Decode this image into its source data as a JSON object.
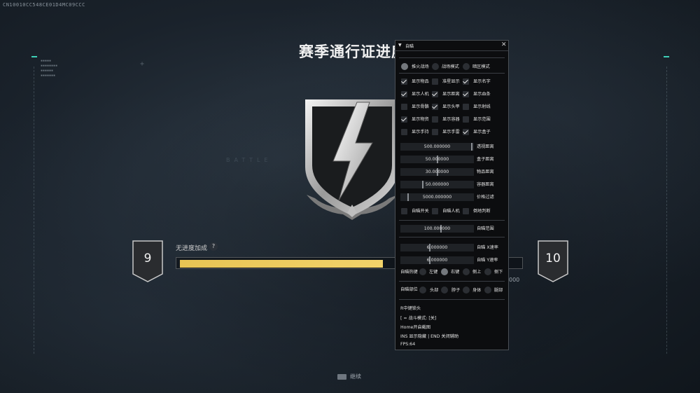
{
  "build_id": "CN10010CC548CE01D4MC09CCC",
  "screen": {
    "title": "赛季通行证进度",
    "current_level": "9",
    "next_level": "10",
    "progress_label": "无进度加成",
    "help_icon_text": "?",
    "progress_fraction": 0.6,
    "xp_suffix": "000",
    "continue_label": "继续",
    "badge_background_text": "BATTLE"
  },
  "menu": {
    "title": "自瞄",
    "close_glyph": "✕",
    "mode_radios": [
      {
        "label": "推火战场",
        "checked": true
      },
      {
        "label": "战场模式",
        "checked": false
      },
      {
        "label": "暗区模式",
        "checked": false
      }
    ],
    "checkboxes": [
      [
        {
          "label": "显示物品",
          "checked": true
        },
        {
          "label": "准星显示",
          "checked": false
        },
        {
          "label": "显示名字",
          "checked": true
        }
      ],
      [
        {
          "label": "显示人机",
          "checked": true
        },
        {
          "label": "显示距离",
          "checked": true
        },
        {
          "label": "显示血条",
          "checked": true
        }
      ],
      [
        {
          "label": "显示骨骼",
          "checked": false
        },
        {
          "label": "显示头甲",
          "checked": true
        },
        {
          "label": "显示射线",
          "checked": false
        }
      ],
      [
        {
          "label": "显示物资",
          "checked": true
        },
        {
          "label": "显示容器",
          "checked": false
        },
        {
          "label": "显示范围",
          "checked": false
        }
      ],
      [
        {
          "label": "显示手持",
          "checked": false
        },
        {
          "label": "显示手雷",
          "checked": false
        },
        {
          "label": "显示盒子",
          "checked": true
        }
      ]
    ],
    "sliders": [
      {
        "value": "500.000000",
        "label": "透视距离",
        "fraction": 0.98
      },
      {
        "value": "50.000000",
        "label": "盒子距离",
        "fraction": 0.5
      },
      {
        "value": "30.000000",
        "label": "物品距离",
        "fraction": 0.5
      },
      {
        "value": "50.000000",
        "label": "容器距离",
        "fraction": 0.3
      },
      {
        "value": "5000.000000",
        "label": "价格过滤",
        "fraction": 0.1
      }
    ],
    "aim_toggles": [
      {
        "label": "自瞄开关",
        "checked": false
      },
      {
        "label": "自瞄人机",
        "checked": false
      },
      {
        "label": "倒地判断",
        "checked": false
      }
    ],
    "range_slider": {
      "value": "100.000000",
      "label": "自瞄范围",
      "fraction": 0.55
    },
    "speed_sliders": [
      {
        "value": "6.000000",
        "label": "自瞄 X速率",
        "fraction": 0.4
      },
      {
        "value": "6.000000",
        "label": "自瞄 Y速率",
        "fraction": 0.4
      }
    ],
    "hotkey": {
      "label": "自瞄热键",
      "options": [
        {
          "label": "左键",
          "checked": false
        },
        {
          "label": "右键",
          "checked": true
        },
        {
          "label": "侧上",
          "checked": false
        },
        {
          "label": "侧下",
          "checked": false
        }
      ]
    },
    "aim_part": {
      "label": "自瞄部位",
      "options": [
        {
          "label": "头部",
          "checked": false
        },
        {
          "label": "脖子",
          "checked": false
        },
        {
          "label": "身体",
          "checked": false
        },
        {
          "label": "腿部",
          "checked": false
        }
      ]
    },
    "info_lines": [
      "R中键锁头",
      "[ = 战斗模式: [关]",
      "Home开启截图",
      "INS 显示隐藏 | END 关闭辅助",
      "FPS:64"
    ]
  }
}
